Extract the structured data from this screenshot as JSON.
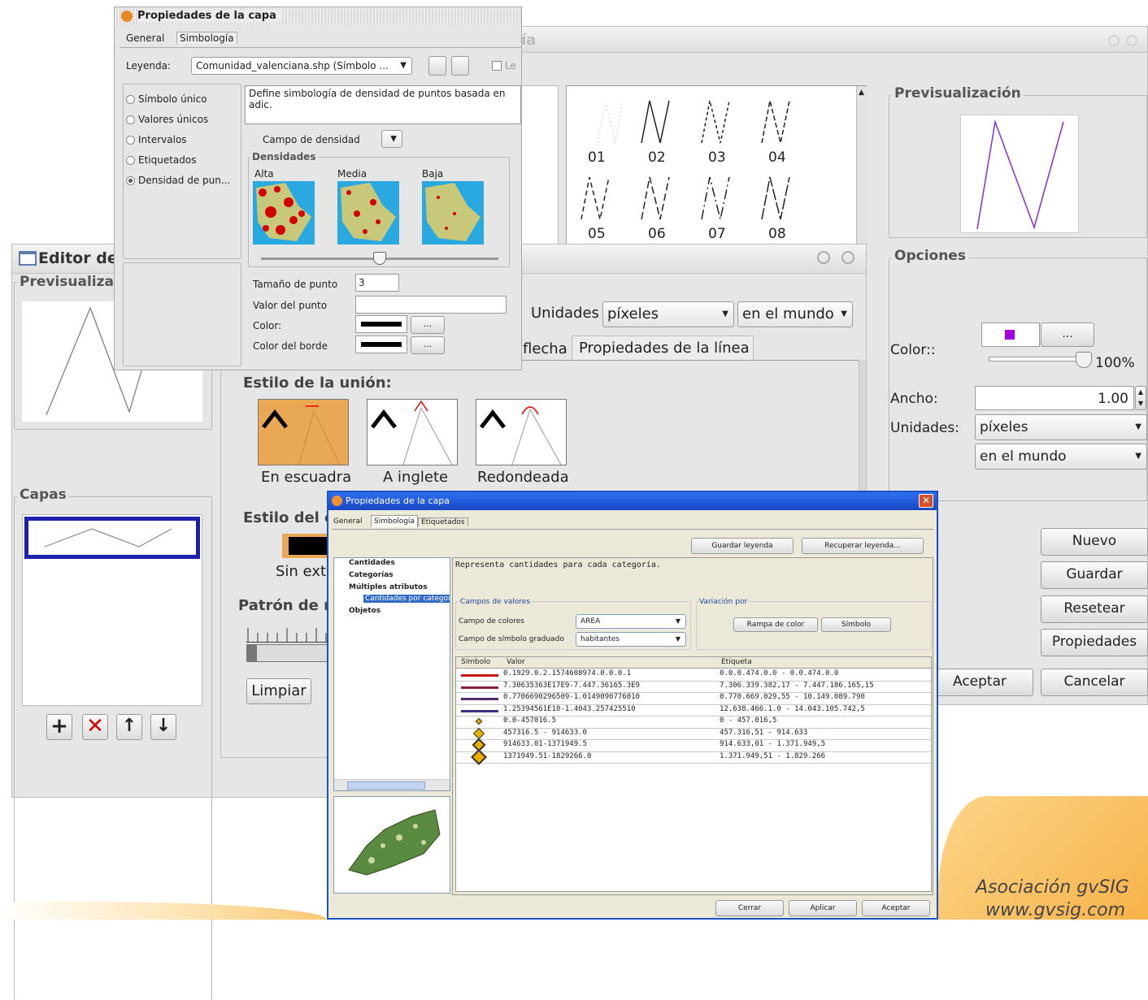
{
  "symbol_window": {
    "title_fragment": "ía",
    "preview_legend": "Previsualización",
    "options_legend": "Opciones",
    "symbol_labels": [
      "01",
      "02",
      "03",
      "04",
      "05",
      "06",
      "07",
      "08"
    ],
    "color_label": "Color::",
    "transparency": "100%",
    "width_label": "Ancho:",
    "width_value": "1.00",
    "units_label": "Unidades:",
    "units_value": "píxeles",
    "reference_value": "en el mundo",
    "buttons": [
      "Nuevo",
      "Guardar",
      "Resetear",
      "Propiedades"
    ],
    "accept": "Aceptar",
    "cancel": "Cancelar",
    "color_swatch": "#a000e0"
  },
  "symbol_editor": {
    "title": "Editor de",
    "preview_legend": "Previsualizac",
    "layers_legend": "Capas",
    "units_label": "Unidades",
    "units_value": "píxeles",
    "reference_value": "en el mundo",
    "tab_arrow": "flecha",
    "tab_line": "Propiedades de la línea",
    "join_style_label": "Estilo de la unión:",
    "join_options": [
      "En escuadra",
      "A inglete",
      "Redondeada"
    ],
    "end_style_label": "Estilo del e",
    "end_option": "Sin extr",
    "pattern_label": "Patrón de re",
    "clear_button": "Limpiar"
  },
  "density_dialog": {
    "title": "Propiedades de la capa",
    "tabs": [
      "General",
      "Simbología"
    ],
    "legend_label": "Leyenda:",
    "legend_value": "Comunidad_valenciana.shp (Símbolo ...",
    "legend_checkbox": "Le",
    "legend_types": [
      "Símbolo único",
      "Valores únicos",
      "Intervalos",
      "Etiquetados",
      "Densidad de pun..."
    ],
    "description": "Define simbología de densidad de puntos basada en adic.",
    "density_field_label": "Campo de densidad",
    "densities_legend": "Densidades",
    "density_levels": [
      "Alta",
      "Media",
      "Baja"
    ],
    "point_size_label": "Tamaño de punto",
    "point_size_value": "3",
    "point_value_label": "Valor del punto",
    "color_label": "Color:",
    "border_color_label": "Color del borde",
    "ellipsis": "..."
  },
  "quantities_dialog": {
    "title": "Propiedades de la capa",
    "tabs": [
      "General",
      "Simbología",
      "Etiquetados"
    ],
    "save_legend": "Guardar leyenda",
    "recover_legend": "Recuperar leyenda...",
    "tree": [
      "Cantidades",
      "Categorías",
      "Múltiples atributos",
      "Cantidades por categoría",
      "Objetos"
    ],
    "description": "Representa cantidades para cada categoría.",
    "values_fields_legend": "Campos de valores",
    "color_field_label": "Campo de colores",
    "color_field_value": "AREA",
    "size_field_label": "Campo de símbolo graduado",
    "size_field_value": "habitantes",
    "variation_legend": "Variación por",
    "ramp_button": "Rampa de color",
    "symbol_button": "Símbolo",
    "columns": [
      "Símbolo",
      "Valor",
      "Etiqueta"
    ],
    "rows": [
      {
        "value": "0.1929.0.2.1574608974.0.0.0.1",
        "label": "0.0.0.474.0.0 - 0.0.474.0.0"
      },
      {
        "value": "7.30635363E17E9-7.447.36165.3E9",
        "label": "7.306.339.382,17 - 7.447.186.165,15"
      },
      {
        "value": "0.7706690296509-1.0149090776010",
        "label": "0.770.669.029,55 - 10.149.089.790"
      },
      {
        "value": "1.25394561E10-1.4043.257425510",
        "label": "12.638.466.1.0 - 14.043.105.742,5"
      },
      {
        "value": "0.0-457016.5",
        "label": "0 - 457.016,5"
      },
      {
        "value": "457316.5 - 914633.0",
        "label": "457.316,51 - 914.633"
      },
      {
        "value": "914633.01-1371949.5",
        "label": "914.633,01 - 1.371.949,5"
      },
      {
        "value": "1371949.51-1829266.0",
        "label": "1.371.949,51 - 1.829.266"
      }
    ],
    "close": "Cerrar",
    "apply": "Aplicar",
    "accept": "Aceptar"
  },
  "branding": {
    "line1": "Asociación gvSIG",
    "line2": "www.gvsig.com"
  }
}
